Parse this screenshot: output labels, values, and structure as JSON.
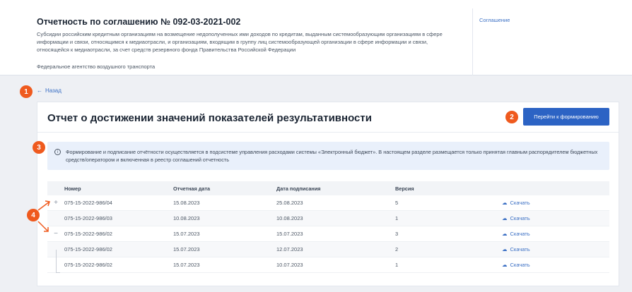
{
  "agreement": {
    "title": "Отчетность по соглашению № 092-03-2021-002",
    "description": "Субсидии российским кредитным организациям на возмещение недополученных ими доходов по кредитам, выданным системообразующим организациям в сфере информации и связи, относящимся к медиаотрасли, и организациям, входящим в группу лиц системообразующей организации в сфере информации и связи, относящейся к медиаотрасли, за счет средств резервного фонда Правительства Российской Федерации",
    "agency": "Федеральное агентство воздушного транспорта",
    "side_link": "Соглашение"
  },
  "nav": {
    "back_label": "Назад"
  },
  "markers": {
    "m1": "1",
    "m2": "2",
    "m3": "3",
    "m4": "4"
  },
  "report": {
    "title": "Отчет о достижении значений показателей результативности",
    "primary_button": "Перейти к формированию",
    "info_text": "Формирование и подписание отчётности осуществляется в подсистеме управления расходами системы «Электронный бюджет». В настоящем разделе размещается только принятая главным распорядителем бюджетных средств/оператором и включенная в реестр соглашений отчетность"
  },
  "table": {
    "headers": {
      "number": "Номер",
      "report_date": "Отчетная дата",
      "sign_date": "Дата подписания",
      "version": "Версия"
    },
    "download_label": "Скачать",
    "rows": [
      {
        "toggle": "+",
        "number": "075-15-2022-986/04",
        "report_date": "15.08.2023",
        "sign_date": "25.08.2023",
        "version": "5"
      },
      {
        "toggle": "",
        "number": "075-15-2022-986/03",
        "report_date": "10.08.2023",
        "sign_date": "10.08.2023",
        "version": "1"
      },
      {
        "toggle": "−",
        "number": "075-15-2022-986/02",
        "report_date": "15.07.2023",
        "sign_date": "15.07.2023",
        "version": "3"
      },
      {
        "toggle": "",
        "number": "075-15-2022-986/02",
        "report_date": "15.07.2023",
        "sign_date": "12.07.2023",
        "version": "2"
      },
      {
        "toggle": "",
        "number": "075-15-2022-986/02",
        "report_date": "15.07.2023",
        "sign_date": "10.07.2023",
        "version": "1"
      }
    ]
  },
  "colors": {
    "accent": "#2c63c4",
    "link": "#3a6fc4",
    "marker": "#ef5a1e",
    "info_bg": "#e9f0fb"
  }
}
